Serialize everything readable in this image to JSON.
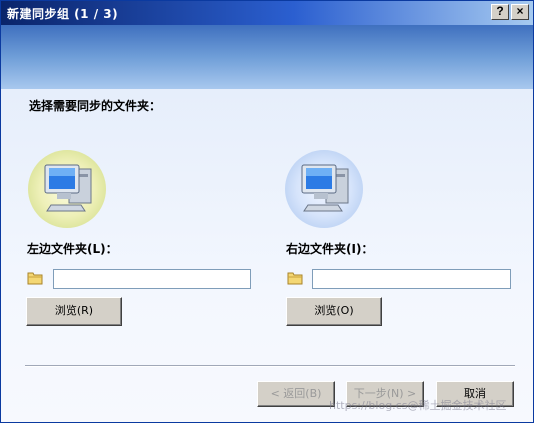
{
  "window": {
    "title": "新建同步组 (1 / 3)"
  },
  "titlebar": {
    "help_label": "?",
    "close_label": "×"
  },
  "prompt": "选择需要同步的文件夹：",
  "left": {
    "label": "左边文件夹(L)：",
    "path": "",
    "browse_label": "浏览(R)"
  },
  "right": {
    "label": "右边文件夹(I)：",
    "path": "",
    "browse_label": "浏览(O)"
  },
  "footer": {
    "back_label": "< 返回(B)",
    "next_label": "下一步(N) >",
    "cancel_label": "取消"
  },
  "watermark": "https://blog.cs@稀土掘金技术社区",
  "icons": {
    "computer": "computer-icon",
    "folder": "folder-icon"
  },
  "colors": {
    "title_bar": "#0a246a",
    "banner": "#6f9ed8",
    "button_face": "#d4d0c8"
  }
}
